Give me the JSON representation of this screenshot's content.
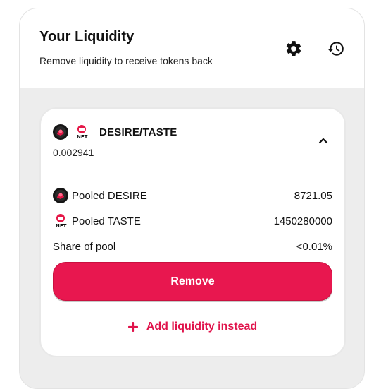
{
  "header": {
    "title": "Your Liquidity",
    "subtitle": "Remove liquidity to receive tokens back",
    "settings_icon": "gear-icon",
    "history_icon": "history-icon"
  },
  "position": {
    "pair": "DESIRE/TASTE",
    "pool_tokens": "0.002941",
    "expanded": true,
    "rows": [
      {
        "label": "Pooled DESIRE",
        "value": "8721.05",
        "icon": "desire-token-icon"
      },
      {
        "label": "Pooled TASTE",
        "value": "1450280000",
        "icon": "taste-token-icon"
      },
      {
        "label": "Share of pool",
        "value": "<0.01%"
      }
    ],
    "remove_label": "Remove",
    "add_label": "Add liquidity instead"
  },
  "colors": {
    "accent": "#e8174f",
    "background": "#ededed",
    "card": "#ffffff"
  }
}
